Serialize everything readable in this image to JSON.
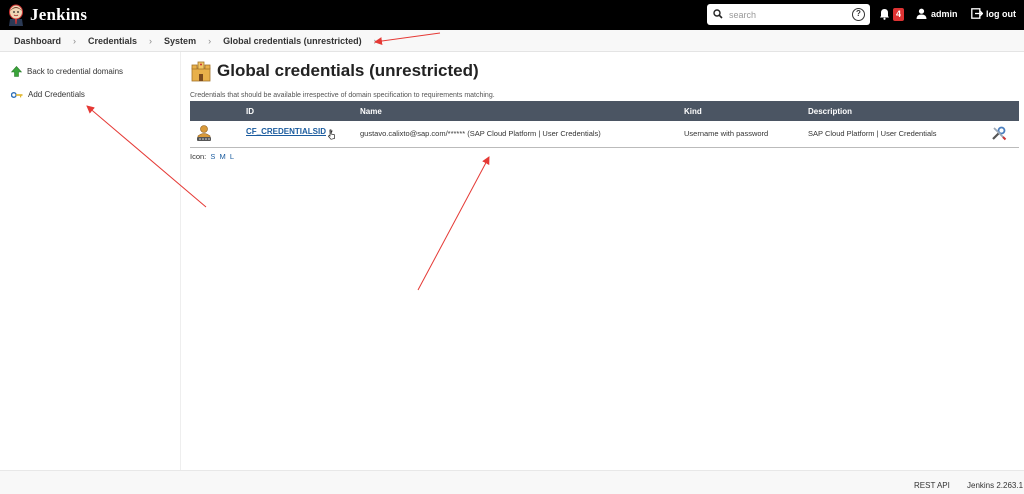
{
  "header": {
    "brand": "Jenkins",
    "search_placeholder": "search",
    "notification_count": "4",
    "user": "admin",
    "logout": "log out"
  },
  "breadcrumbs": [
    "Dashboard",
    "Credentials",
    "System",
    "Global credentials (unrestricted)"
  ],
  "sidebar": {
    "items": [
      {
        "label": "Back to credential domains",
        "icon": "up-arrow-icon"
      },
      {
        "label": "Add Credentials",
        "icon": "key-icon"
      }
    ]
  },
  "main": {
    "title": "Global credentials (unrestricted)",
    "description": "Credentials that should be available irrespective of domain specification to requirements matching.",
    "table": {
      "columns": [
        "ID",
        "Name",
        "Kind",
        "Description"
      ],
      "rows": [
        {
          "id": "CF_CREDENTIALSID",
          "name": "gustavo.calixto@sap.com/****** (SAP Cloud Platform | User Credentials)",
          "kind": "Username with password",
          "description": "SAP Cloud Platform | User Credentials"
        }
      ]
    },
    "icon_label": "Icon:",
    "icon_sizes": [
      "S",
      "M",
      "L"
    ]
  },
  "footer": {
    "rest_api": "REST API",
    "version": "Jenkins 2.263.1"
  },
  "colors": {
    "header_bg": "#000000",
    "table_header_bg": "#4b5563",
    "link": "#1a5b9e",
    "badge": "#dd3333",
    "annotation_arrow": "#e53935"
  }
}
